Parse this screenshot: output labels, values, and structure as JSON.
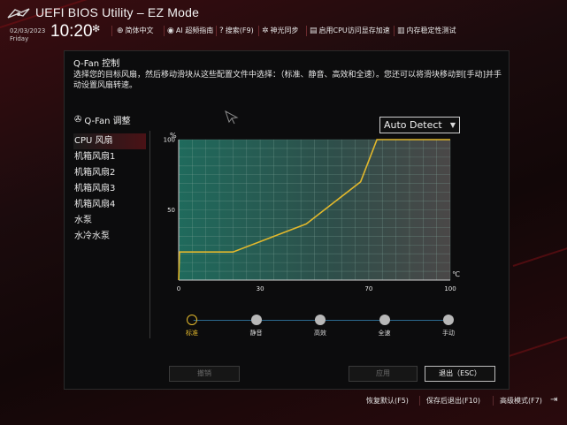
{
  "header": {
    "title": "UEFI BIOS Utility – EZ Mode",
    "date": "02/03/2023",
    "weekday": "Friday",
    "time": "10:20",
    "menu": [
      {
        "icon": "globe-icon",
        "glyph": "⊕",
        "label": "简体中文"
      },
      {
        "icon": "ai-overclock-icon",
        "glyph": "◉",
        "label": "AI 超频指南"
      },
      {
        "icon": "search-icon",
        "glyph": "?",
        "label": "搜索(F9)"
      },
      {
        "icon": "aura-icon",
        "glyph": "✲",
        "label": "神光同步"
      },
      {
        "icon": "memory-icon",
        "glyph": "▤",
        "label": "启用CPU访问显存加速"
      },
      {
        "icon": "memtest-icon",
        "glyph": "▥",
        "label": "内存稳定性测试"
      }
    ]
  },
  "dialog": {
    "title": "Q-Fan 控制",
    "description": "选择您的目标风扇，然后移动滑块从这些配置文件中选择：（标准、静音、高效和全速）。您还可以将滑块移动到[手动]并手动设置风扇转速。",
    "section_title": "Q-Fan 调整",
    "fans": [
      "CPU 风扇",
      "机箱风扇1",
      "机箱风扇2",
      "机箱风扇3",
      "机箱风扇4",
      "水泵",
      "水冷水泵"
    ],
    "selected_fan": "CPU 风扇",
    "mode_select": "Auto Detect",
    "presets": [
      "标准",
      "静音",
      "高效",
      "全速",
      "手动"
    ],
    "active_preset": "标准",
    "buttons": {
      "undo": "撤销",
      "apply": "应用",
      "exit": "退出（ESC）"
    }
  },
  "chart_data": {
    "type": "line",
    "xlabel": "℃",
    "ylabel": "%",
    "xlim": [
      0,
      100
    ],
    "ylim": [
      0,
      100
    ],
    "x_ticks": [
      0,
      30,
      70,
      100
    ],
    "y_ticks": [
      50,
      100
    ],
    "grid": true,
    "series": [
      {
        "color": "#e2b82c",
        "x": [
          0,
          0.3,
          20,
          47,
          67,
          73,
          100
        ],
        "y": [
          0,
          20,
          20,
          40,
          70,
          100,
          100
        ]
      }
    ]
  },
  "footer": {
    "items": [
      "恢复默认(F5)",
      "保存后退出(F10)",
      "高级模式(F7)"
    ]
  },
  "colors": {
    "accent": "#e2b82c",
    "track": "#2d6b90",
    "brand": "#c01a22"
  }
}
